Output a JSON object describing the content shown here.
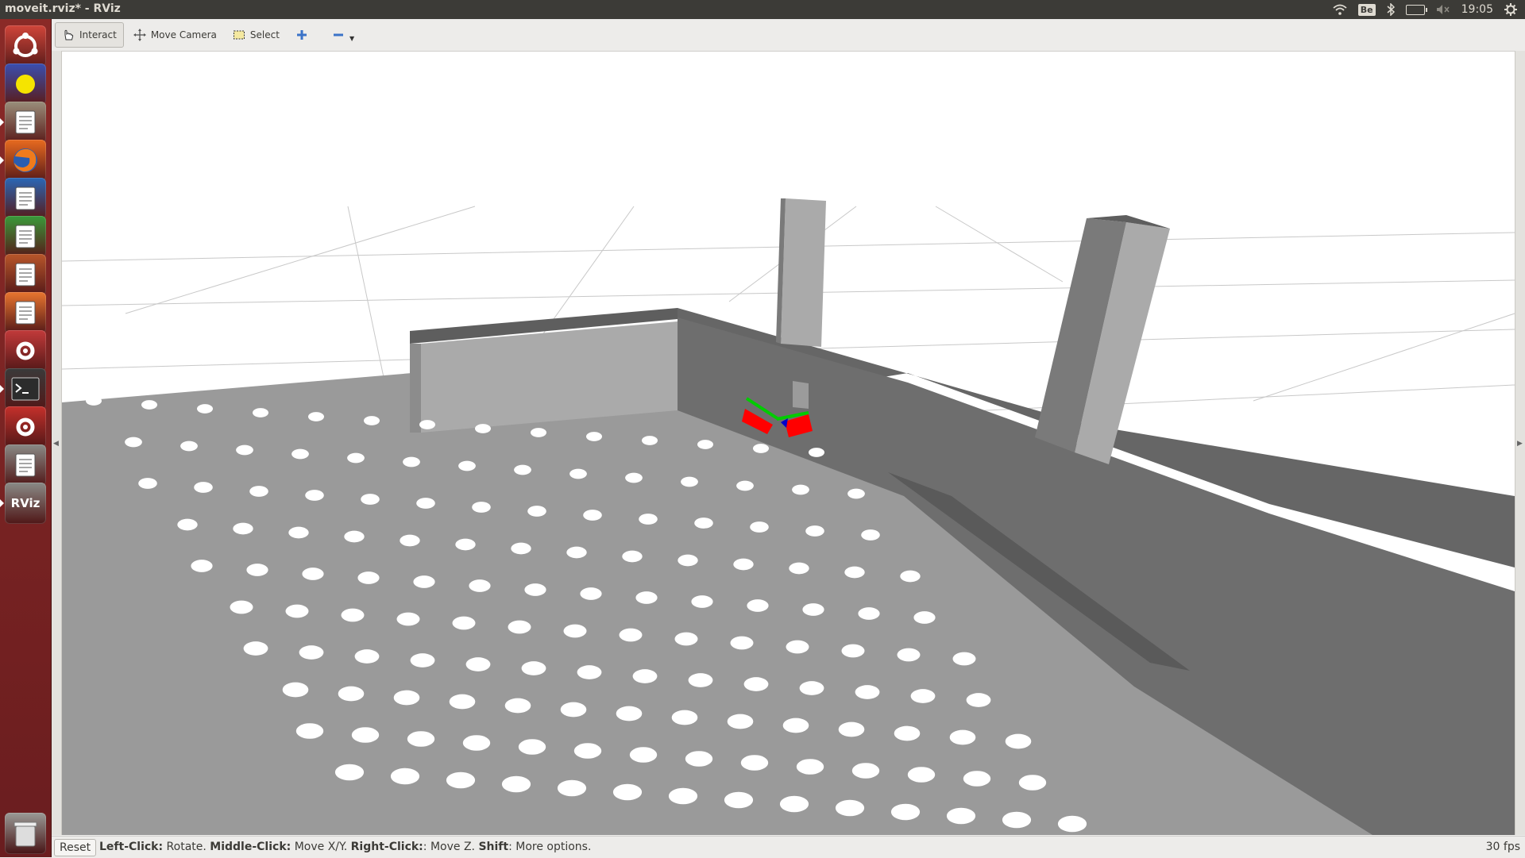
{
  "window": {
    "title": "moveit.rviz* - RViz"
  },
  "tray": {
    "keyboard_layout": "Be",
    "clock": "19:05"
  },
  "launcher": {
    "items": [
      {
        "name": "dash-home-icon",
        "color": "#d0453a"
      },
      {
        "name": "system-monitor-icon",
        "color": "#3a4fb0"
      },
      {
        "name": "files-icon",
        "color": "#9a8e7a"
      },
      {
        "name": "firefox-icon",
        "color": "#e86a1f"
      },
      {
        "name": "writer-icon",
        "color": "#2a67b6"
      },
      {
        "name": "calc-icon",
        "color": "#3a9a3a"
      },
      {
        "name": "impress-icon",
        "color": "#b8562a"
      },
      {
        "name": "software-center-icon",
        "color": "#e8752f"
      },
      {
        "name": "system-settings-icon",
        "color": "#c23a3a"
      },
      {
        "name": "terminal-icon",
        "color": "#3a3a3a"
      },
      {
        "name": "settings-gear-icon",
        "color": "#c4302b"
      },
      {
        "name": "text-editor-icon",
        "color": "#8a8a86"
      },
      {
        "name": "rviz-icon",
        "color": "#8a8a86"
      },
      {
        "name": "trash-icon",
        "color": "#9a9a96"
      }
    ],
    "rviz_label": "RViz"
  },
  "toolbar": {
    "interact_label": "Interact",
    "move_camera_label": "Move Camera",
    "select_label": "Select"
  },
  "statusbar": {
    "reset_label": "Reset",
    "hint_left_click_key": "Left-Click:",
    "hint_left_click_action": " Rotate. ",
    "hint_middle_click_key": "Middle-Click:",
    "hint_middle_click_action": " Move X/Y. ",
    "hint_right_click_key": "Right-Click:",
    "hint_right_click_action": ": Move Z. ",
    "hint_shift_key": "Shift",
    "hint_shift_action": ": More options.",
    "fps": "30 fps"
  },
  "scene": {
    "background": "#ffffff",
    "grid_color": "#c8c8c8",
    "floor_color": "#9a9a9a",
    "wall_color": "#6e6e6e",
    "wall_light": "#aaaaaa",
    "gripper_color": "#ff0000",
    "axis_green": "#00cc00",
    "axis_blue": "#0000cc"
  }
}
